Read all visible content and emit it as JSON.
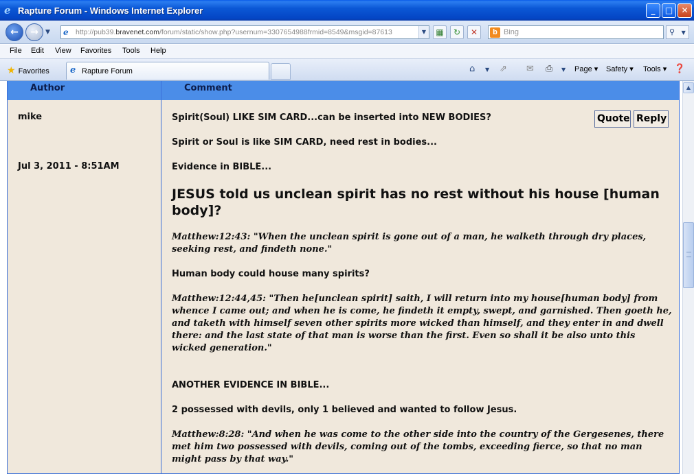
{
  "window": {
    "title": "Rapture Forum - Windows Internet Explorer",
    "minimize": "_",
    "maximize": "□",
    "close": "✕"
  },
  "addressbar": {
    "url_prefix": "http://pub39.",
    "url_domain": "bravenet.com",
    "url_rest": "/forum/static/show.php?usernum=3307654988frmid=8549&msgid=87613",
    "search_placeholder": "Bing",
    "search_brand": "b"
  },
  "menu": [
    "File",
    "Edit",
    "View",
    "Favorites",
    "Tools",
    "Help"
  ],
  "tabbar": {
    "favorites_label": "Favorites",
    "tab_label": "Rapture Forum",
    "page_label": "Page ▾",
    "safety_label": "Safety ▾",
    "tools_label": "Tools ▾"
  },
  "forum": {
    "author_header": "Author",
    "comment_header": "Comment",
    "author": "mike",
    "date": "Jul 3, 2011 - 8:51AM",
    "quote_label": "Quote",
    "reply_label": "Reply",
    "post": {
      "subject": "Spirit(Soul) LIKE SIM CARD...can be inserted into NEW BODIES?",
      "line1": "Spirit or Soul is like SIM CARD, need rest in bodies...",
      "line2": "Evidence in BIBLE...",
      "heading": "JESUS told us unclean spirit has no rest without his house [human body]?",
      "quote1": "Matthew:12:43: \"When the unclean spirit is gone out of a man, he walketh through dry places, seeking rest, and findeth none.\"",
      "line3": "Human body could house many spirits?",
      "quote2": "Matthew:12:44,45: \"Then he[unclean spirit] saith, I will return into my house[human body] from whence I came out; and when he is come, he findeth it empty, swept, and garnished. Then goeth he, and taketh with himself seven other spirits more wicked than himself, and they enter in and dwell there: and the last state of that man is worse than the first. Even so shall it be also unto this wicked generation.\"",
      "line4": "ANOTHER EVIDENCE IN BIBLE...",
      "line5": "2 possessed with devils, only 1 believed and wanted to follow Jesus.",
      "quote3": "Matthew:8:28: \"And when he was come to the other side into the country of the Gergesenes, there met him two possessed with devils, coming out of the tombs, exceeding fierce, so that no man might pass by that way.\""
    }
  },
  "colors": {
    "titlebar": "#0b58d6",
    "forum_header": "#4b8de8",
    "forum_body": "#f0e8dc",
    "border": "#3a6fd8"
  }
}
